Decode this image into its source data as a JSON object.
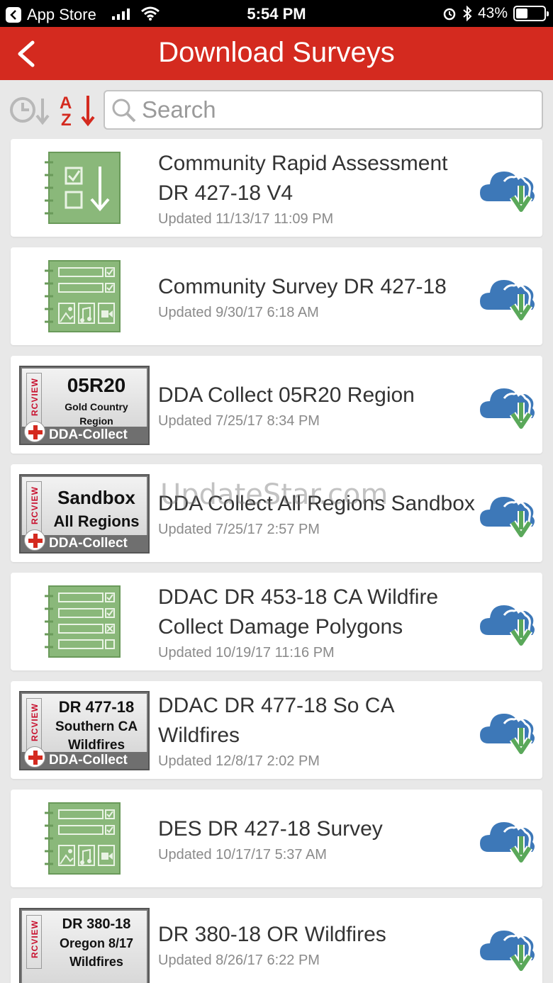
{
  "status": {
    "app": "App Store",
    "time": "5:54 PM",
    "battery": "43%",
    "battery_level": 0.43
  },
  "nav": {
    "title": "Download Surveys"
  },
  "search": {
    "placeholder": "Search",
    "value": ""
  },
  "surveys": [
    {
      "name": "Community Rapid Assessment DR 427-18 V4",
      "updated": "Updated 11/13/17 11:09 PM",
      "icon": "checklist-download-icon"
    },
    {
      "name": "Community Survey DR 427-18",
      "updated": "Updated 9/30/17 6:18 AM",
      "icon": "form-media-icon"
    },
    {
      "name": "DDA Collect 05R20 Region",
      "updated": "Updated 7/25/17 8:34 PM",
      "icon": "rcview-badge",
      "badge": {
        "side": "RCVIEW",
        "lines": [
          "05R20",
          "Gold Country",
          "Region"
        ],
        "foot": "DDA-Collect"
      }
    },
    {
      "name": "DDA Collect All Regions Sandbox",
      "updated": "Updated 7/25/17 2:57 PM",
      "icon": "rcview-badge",
      "badge": {
        "side": "RCVIEW",
        "lines": [
          "Sandbox",
          "All Regions"
        ],
        "foot": "DDA-Collect"
      }
    },
    {
      "name": "DDAC DR 453-18 CA Wildfire Collect Damage Polygons",
      "updated": "Updated 10/19/17 11:16 PM",
      "icon": "form-list-icon"
    },
    {
      "name": "DDAC DR 477-18 So CA Wildfires",
      "updated": "Updated 12/8/17 2:02 PM",
      "icon": "rcview-badge",
      "badge": {
        "side": "RCVIEW",
        "lines": [
          "DR 477-18",
          "Southern CA",
          "Wildfires"
        ],
        "foot": "DDA-Collect"
      }
    },
    {
      "name": "DES DR 427-18 Survey",
      "updated": "Updated 10/17/17 5:37 AM",
      "icon": "form-media-icon"
    },
    {
      "name": "DR 380-18 OR Wildfires",
      "updated": "Updated 8/26/17 6:22 PM",
      "icon": "rcview-badge",
      "badge": {
        "side": "RCVIEW",
        "lines": [
          "DR 380-18",
          "Oregon 8/17",
          "Wildfires"
        ],
        "foot": ""
      }
    }
  ],
  "watermark": "UpdateStar.com",
  "colors": {
    "brand_red": "#d42a1f",
    "icon_green": "#8ab87a",
    "cloud_blue": "#3d78b8",
    "arrow_green": "#5aa85a"
  }
}
